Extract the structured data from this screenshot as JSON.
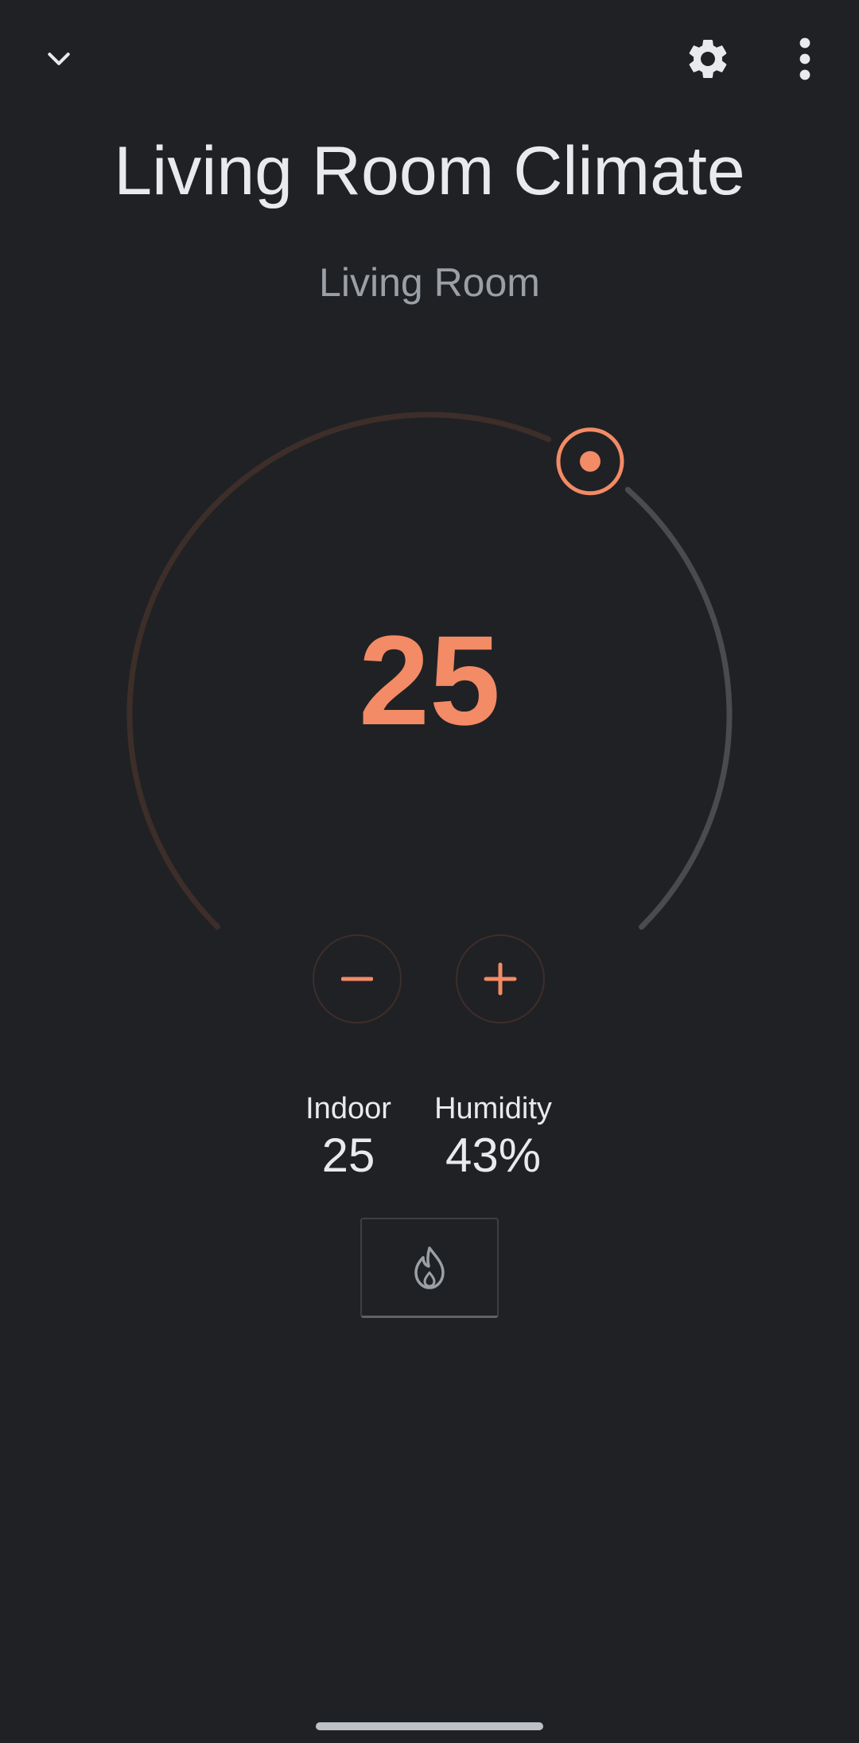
{
  "toolbar": {
    "back_icon": "chevron-down-icon",
    "settings_icon": "gear-icon",
    "more_icon": "more-vert-icon"
  },
  "header": {
    "title": "Living Room Climate",
    "room": "Living Room"
  },
  "thermostat": {
    "setpoint": "25",
    "controls": {
      "decrease_symbol": "−",
      "increase_symbol": "+"
    },
    "dial": {
      "setpoint_fraction": 0.62
    }
  },
  "stats": {
    "indoor": {
      "label": "Indoor",
      "value": "25"
    },
    "humidity": {
      "label": "Humidity",
      "value": "43%"
    }
  },
  "mode": {
    "icon": "flame-icon"
  },
  "colors": {
    "background": "#202124",
    "accent": "#f28b66",
    "track_active": "#3d2e2a",
    "track_inactive": "#4a4b4e",
    "text_primary": "#e8eaed",
    "text_secondary": "#9aa0a6"
  }
}
